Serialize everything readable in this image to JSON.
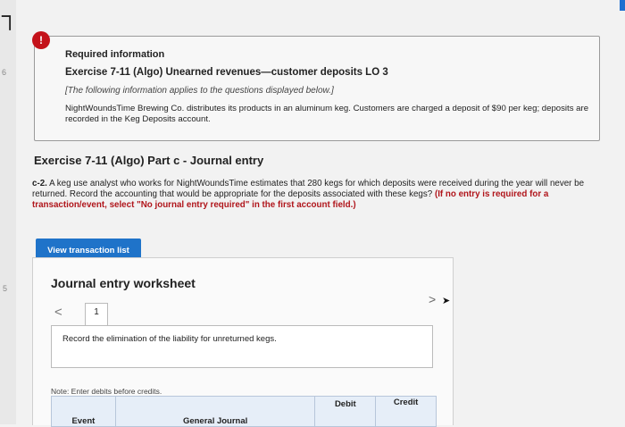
{
  "left_gutter_marks": [
    "6",
    "5"
  ],
  "info": {
    "badge": "!",
    "heading": "Required information",
    "title": "Exercise 7-11 (Algo) Unearned revenues—customer deposits LO 3",
    "note": "[The following information applies to the questions displayed below.]",
    "body": "NightWoundsTime Brewing Co. distributes its products in an aluminum keg. Customers are charged a deposit of $90 per keg; deposits are recorded in the Keg Deposits account."
  },
  "part_title": "Exercise 7-11 (Algo) Part c - Journal entry",
  "question": {
    "label": "c-2.",
    "text": " A keg use analyst who works for NightWoundsTime estimates that 280 kegs for which deposits were received during the year will never be returned. Record the accounting that would be appropriate for the deposits associated with these kegs? ",
    "instruction": "(If no entry is required for a transaction/event, select \"No journal entry required\" in the first account field.)"
  },
  "view_button_label": "View transaction list",
  "worksheet": {
    "title": "Journal entry worksheet",
    "prev_icon": "<",
    "next_icon": ">",
    "tab_number": "1",
    "record_text": "Record the elimination of the liability for unreturned kegs.",
    "note": "Note: Enter debits before credits.",
    "columns": {
      "event": "Event",
      "general_journal": "General Journal",
      "debit": "Debit",
      "credit": "Credit"
    }
  }
}
